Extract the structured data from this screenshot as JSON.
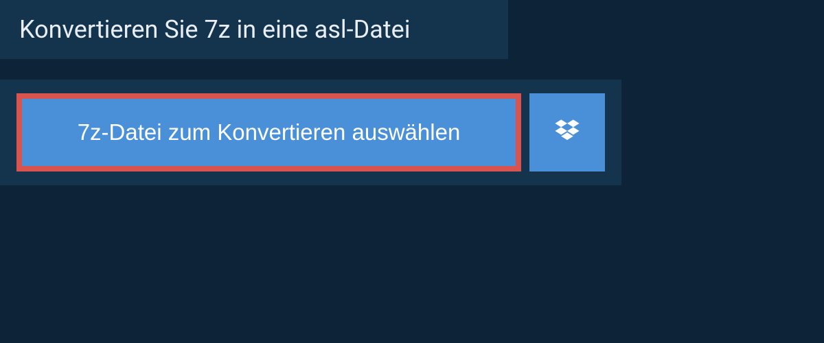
{
  "header": {
    "title": "Konvertieren Sie 7z in eine asl-Datei"
  },
  "upload": {
    "select_button_label": "7z-Datei zum Konvertieren auswählen"
  }
}
